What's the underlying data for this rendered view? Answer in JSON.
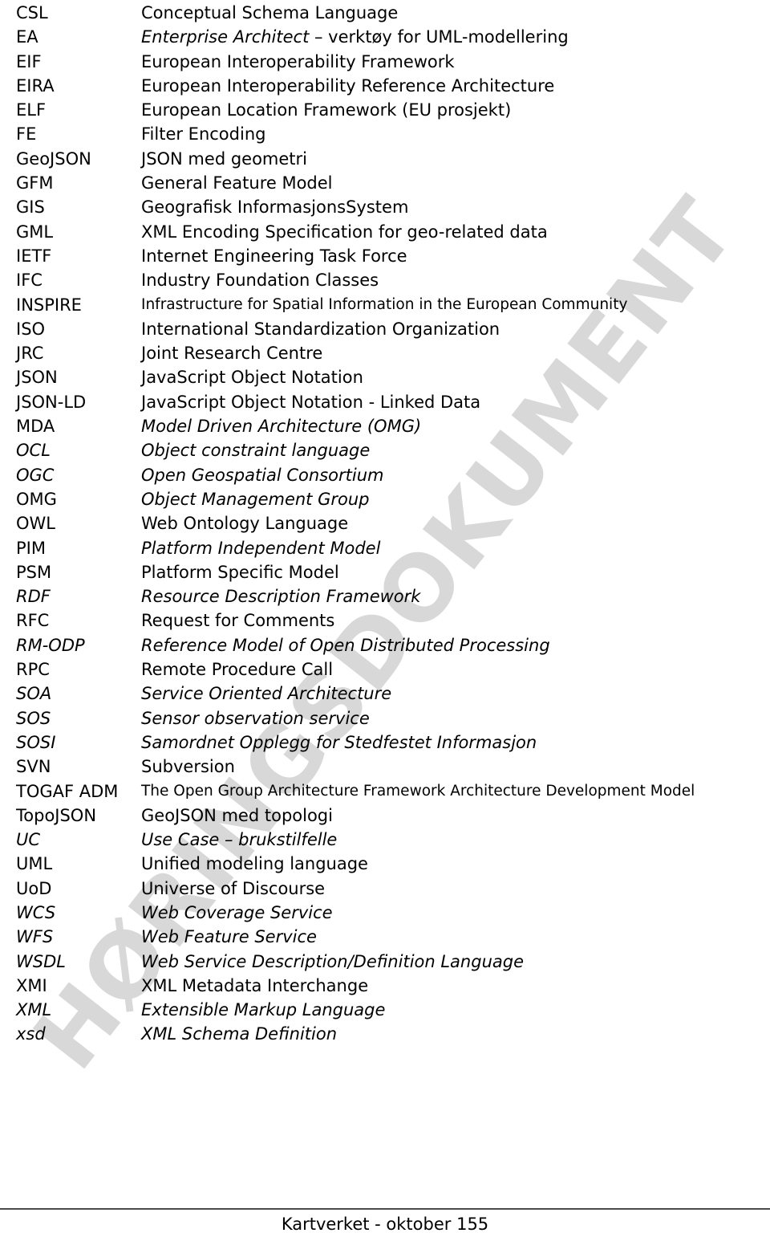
{
  "watermark": {
    "text": "HØRINGSDOKUMENT",
    "color": "#d8d8d8"
  },
  "glossary": {
    "rows": [
      {
        "abbr": "CSL",
        "abbr_style": "up",
        "def": "Conceptual Schema Language",
        "def_style": "up",
        "size": "normal"
      },
      {
        "abbr": "EA",
        "abbr_style": "up",
        "def": "Enterprise Architect – verktøy for UML-modellering",
        "def_style": "mixed",
        "def_italic_part": "Enterprise Architect",
        "def_upright_part": " – verktøy for UML-modellering",
        "size": "normal"
      },
      {
        "abbr": "EIF",
        "abbr_style": "up",
        "def": "European Interoperability Framework",
        "def_style": "up",
        "size": "normal"
      },
      {
        "abbr": "EIRA",
        "abbr_style": "up",
        "def": "European Interoperability Reference Architecture",
        "def_style": "up",
        "size": "normal"
      },
      {
        "abbr": "ELF",
        "abbr_style": "up",
        "def": "European Location Framework (EU prosjekt)",
        "def_style": "up",
        "size": "normal"
      },
      {
        "abbr": "FE",
        "abbr_style": "up",
        "def": "Filter Encoding",
        "def_style": "up",
        "size": "normal"
      },
      {
        "abbr": "GeoJSON",
        "abbr_style": "up",
        "def": "JSON med geometri",
        "def_style": "up",
        "size": "normal"
      },
      {
        "abbr": "GFM",
        "abbr_style": "up",
        "def": "General Feature Model",
        "def_style": "up",
        "size": "normal"
      },
      {
        "abbr": "GIS",
        "abbr_style": "up",
        "def": "Geografisk InformasjonsSystem",
        "def_style": "up",
        "size": "normal"
      },
      {
        "abbr": "GML",
        "abbr_style": "up",
        "def": "XML Encoding Specification for geo-related data",
        "def_style": "up",
        "size": "normal"
      },
      {
        "abbr": "IETF",
        "abbr_style": "up",
        "def": "Internet Engineering Task Force",
        "def_style": "up",
        "size": "normal"
      },
      {
        "abbr": "IFC",
        "abbr_style": "up",
        "def": "Industry Foundation Classes",
        "def_style": "up",
        "size": "normal"
      },
      {
        "abbr": "INSPIRE",
        "abbr_style": "up",
        "def": "Infrastructure for Spatial Information in the European Community",
        "def_style": "up",
        "size": "small"
      },
      {
        "abbr": "ISO",
        "abbr_style": "up",
        "def": "International Standardization Organization",
        "def_style": "up",
        "size": "normal"
      },
      {
        "abbr": "JRC",
        "abbr_style": "up",
        "def": "Joint Research Centre",
        "def_style": "up",
        "size": "normal"
      },
      {
        "abbr": "JSON",
        "abbr_style": "up",
        "def": "JavaScript Object Notation",
        "def_style": "up",
        "size": "normal"
      },
      {
        "abbr": "JSON-LD",
        "abbr_style": "up",
        "def": "JavaScript Object Notation - Linked Data",
        "def_style": "up",
        "size": "normal"
      },
      {
        "abbr": "MDA",
        "abbr_style": "up",
        "def": "Model Driven Architecture (OMG)",
        "def_style": "it",
        "size": "normal"
      },
      {
        "abbr": "OCL",
        "abbr_style": "it",
        "def": "Object constraint language",
        "def_style": "it",
        "size": "normal"
      },
      {
        "abbr": "OGC",
        "abbr_style": "it",
        "def": "Open Geospatial Consortium",
        "def_style": "it",
        "size": "normal"
      },
      {
        "abbr": "OMG",
        "abbr_style": "up",
        "def": "Object Management Group",
        "def_style": "it",
        "size": "normal"
      },
      {
        "abbr": "OWL",
        "abbr_style": "up",
        "def": "Web Ontology Language",
        "def_style": "up",
        "size": "normal"
      },
      {
        "abbr": "PIM",
        "abbr_style": "up",
        "def": "Platform Independent Model",
        "def_style": "it",
        "size": "normal"
      },
      {
        "abbr": "PSM",
        "abbr_style": "up",
        "def": "Platform Specific Model",
        "def_style": "up",
        "size": "normal"
      },
      {
        "abbr": "RDF",
        "abbr_style": "it",
        "def": "Resource Description Framework",
        "def_style": "it",
        "size": "normal"
      },
      {
        "abbr": "RFC",
        "abbr_style": "up",
        "def": "Request for Comments",
        "def_style": "up",
        "size": "normal"
      },
      {
        "abbr": "RM-ODP",
        "abbr_style": "it",
        "def": "Reference Model of Open Distributed Processing",
        "def_style": "it",
        "size": "normal"
      },
      {
        "abbr": "RPC",
        "abbr_style": "up",
        "def": "Remote Procedure Call",
        "def_style": "up",
        "size": "normal"
      },
      {
        "abbr": "SOA",
        "abbr_style": "it",
        "def": "Service Oriented Architecture",
        "def_style": "it",
        "size": "normal"
      },
      {
        "abbr": "SOS",
        "abbr_style": "it",
        "def": "Sensor observation service",
        "def_style": "it",
        "size": "normal"
      },
      {
        "abbr": "SOSI",
        "abbr_style": "it",
        "def": "Samordnet Opplegg for Stedfestet Informasjon",
        "def_style": "it",
        "size": "normal"
      },
      {
        "abbr": "SVN",
        "abbr_style": "up",
        "def": "Subversion",
        "def_style": "up",
        "size": "normal"
      },
      {
        "abbr": "TOGAF ADM",
        "abbr_style": "up",
        "def": "The Open Group Architecture Framework Architecture Development Model",
        "def_style": "up",
        "size": "small"
      },
      {
        "abbr": "TopoJSON",
        "abbr_style": "up",
        "def": "GeoJSON med topologi",
        "def_style": "up",
        "size": "normal"
      },
      {
        "abbr": "UC",
        "abbr_style": "it",
        "def": "Use Case – brukstilfelle",
        "def_style": "it",
        "size": "normal"
      },
      {
        "abbr": "UML",
        "abbr_style": "up",
        "def": "Unified modeling language",
        "def_style": "up",
        "size": "normal"
      },
      {
        "abbr": "UoD",
        "abbr_style": "up",
        "def": "Universe of Discourse",
        "def_style": "up",
        "size": "normal"
      },
      {
        "abbr": "WCS",
        "abbr_style": "it",
        "def": "Web Coverage Service",
        "def_style": "it",
        "size": "normal"
      },
      {
        "abbr": "WFS",
        "abbr_style": "it",
        "def": "Web Feature Service",
        "def_style": "it",
        "size": "normal"
      },
      {
        "abbr": "WSDL",
        "abbr_style": "it",
        "def": "Web Service Description/Definition Language",
        "def_style": "it",
        "size": "normal"
      },
      {
        "abbr": "XMI",
        "abbr_style": "up",
        "def": "XML Metadata Interchange",
        "def_style": "up",
        "size": "normal"
      },
      {
        "abbr": "XML",
        "abbr_style": "it",
        "def": "Extensible Markup Language",
        "def_style": "it",
        "size": "normal"
      },
      {
        "abbr": "xsd",
        "abbr_style": "it",
        "def": "XML Schema Definition",
        "def_style": "it",
        "size": "normal"
      }
    ]
  },
  "footer": {
    "text": "Kartverket - oktober 155"
  }
}
